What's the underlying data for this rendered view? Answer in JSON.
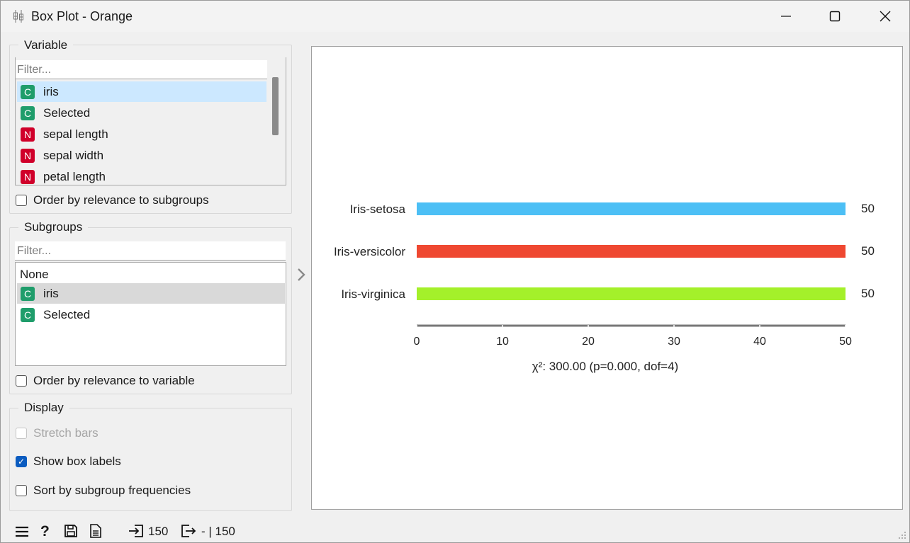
{
  "window": {
    "title": "Box Plot - Orange",
    "minimize_icon": "minimize-icon",
    "maximize_icon": "maximize-icon",
    "close_icon": "close-icon"
  },
  "variable": {
    "title": "Variable",
    "filter_placeholder": "Filter...",
    "items": [
      {
        "badge": "C",
        "label": "iris"
      },
      {
        "badge": "C",
        "label": "Selected"
      },
      {
        "badge": "N",
        "label": "sepal length"
      },
      {
        "badge": "N",
        "label": "sepal width"
      },
      {
        "badge": "N",
        "label": "petal length"
      }
    ],
    "order_label": "Order by relevance to subgroups"
  },
  "subgroups": {
    "title": "Subgroups",
    "filter_placeholder": "Filter...",
    "none_label": "None",
    "items": [
      {
        "badge": "C",
        "label": "iris"
      },
      {
        "badge": "C",
        "label": "Selected"
      }
    ],
    "order_label": "Order by relevance to variable"
  },
  "display": {
    "title": "Display",
    "stretch_label": "Stretch bars",
    "show_labels_label": "Show box labels",
    "sort_label": "Sort by subgroup frequencies"
  },
  "colors": {
    "setosa": "#4cbff5",
    "versicolor": "#ef4831",
    "virginica": "#a4f02a",
    "checked": "#0b5cc0"
  },
  "chart_data": {
    "type": "bar",
    "orientation": "horizontal",
    "categories": [
      "Iris-setosa",
      "Iris-versicolor",
      "Iris-virginica"
    ],
    "values": [
      50,
      50,
      50
    ],
    "value_labels": [
      "50",
      "50",
      "50"
    ],
    "xlim": [
      0,
      50
    ],
    "xticks": [
      "0",
      "10",
      "20",
      "30",
      "40",
      "50"
    ],
    "footer": "χ²: 300.00 (p=0.000, dof=4)",
    "colors": [
      "#4cbff5",
      "#ef4831",
      "#a4f02a"
    ],
    "grid": false
  },
  "status": {
    "icons": [
      "menu-icon",
      "help-icon",
      "save-icon",
      "report-icon",
      "input-icon",
      "output-icon"
    ],
    "input_count": "150",
    "output_text": "- | 150"
  }
}
